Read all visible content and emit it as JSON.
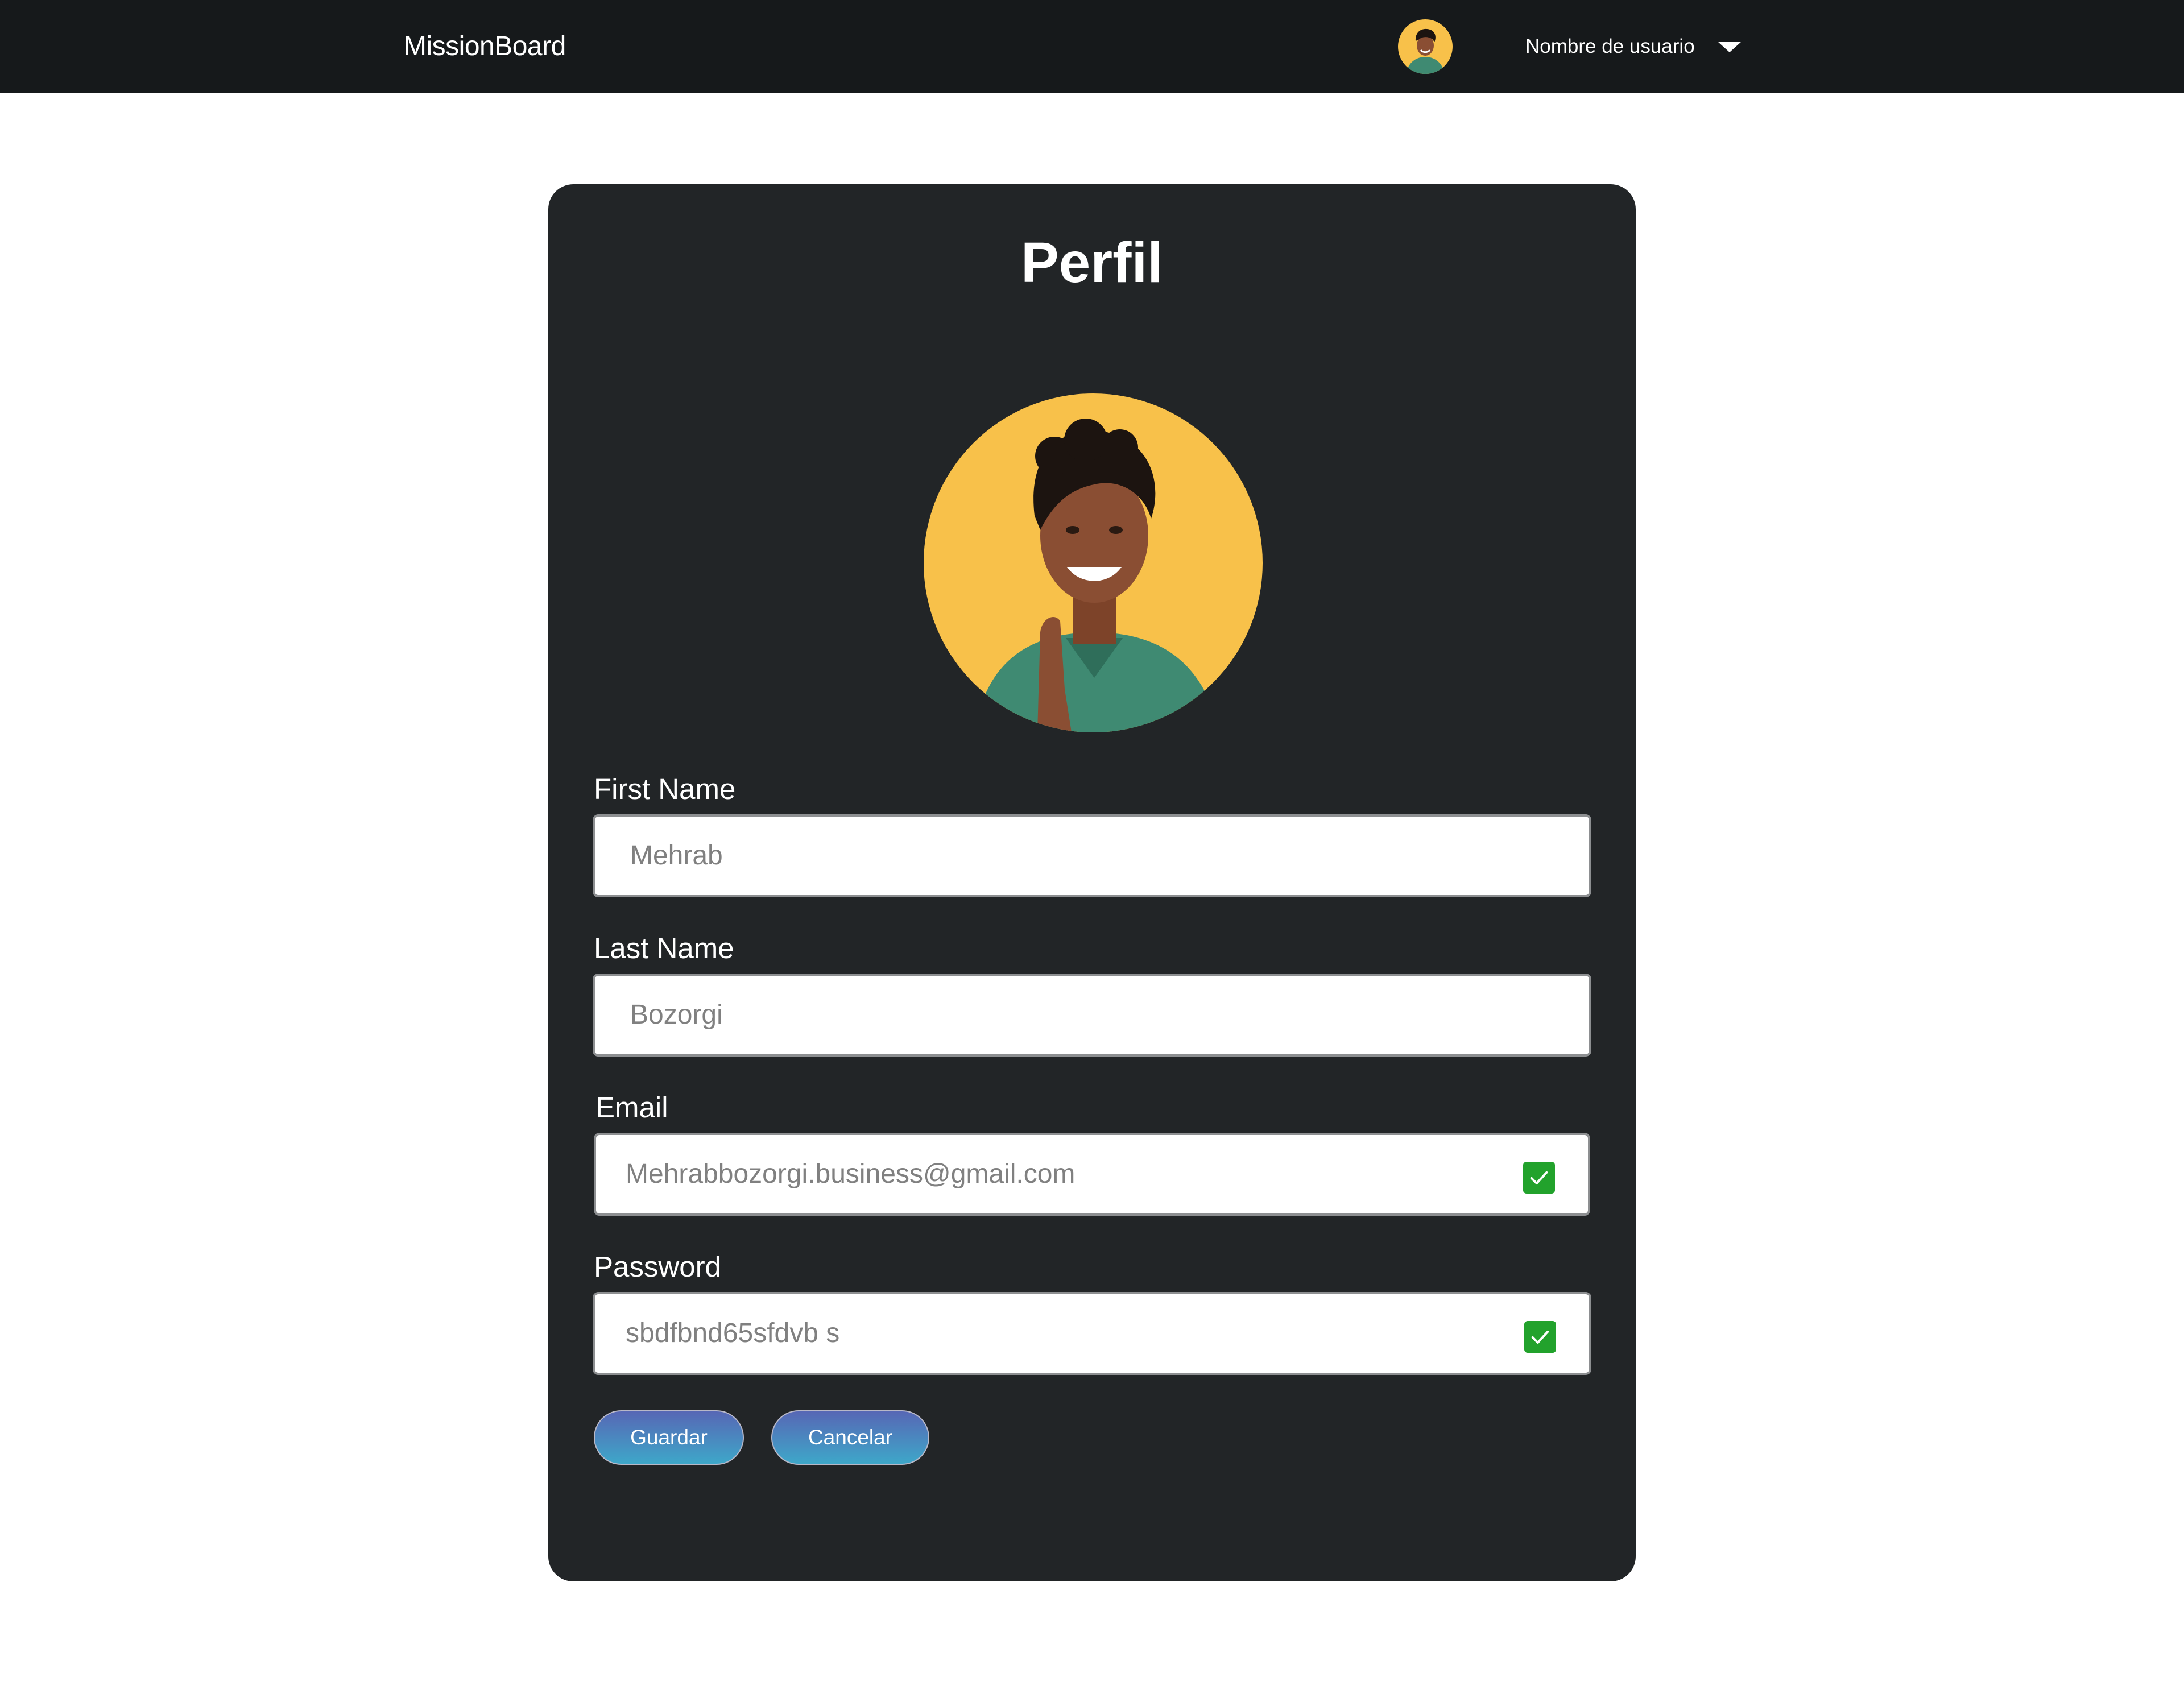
{
  "app": {
    "brand": "MissionBoard"
  },
  "navbar": {
    "username": "Nombre de usuario",
    "avatar_icon": "user-avatar"
  },
  "profile": {
    "title": "Perfil",
    "icons": {
      "upload": "upload-cloud-icon",
      "remove": "remove-circle-icon"
    },
    "fields": {
      "first_name": {
        "label": "First Name",
        "value": "Mehrab"
      },
      "last_name": {
        "label": "Last Name",
        "value": "Bozorgi"
      },
      "email": {
        "label": "Email",
        "value": "Mehrabbozorgi.business@gmail.com",
        "valid": true
      },
      "password": {
        "label": "Password",
        "value": "sbdfbnd65sfdvb s",
        "valid": true
      }
    },
    "buttons": {
      "save": "Guardar",
      "cancel": "Cancelar"
    }
  },
  "colors": {
    "navbar_bg": "#16191b",
    "card_bg": "#222527",
    "avatar_bg": "#f8c14a",
    "check_green": "#22a22c",
    "button_gradient_top": "#5767b5",
    "button_gradient_bottom": "#3ea7c9"
  }
}
